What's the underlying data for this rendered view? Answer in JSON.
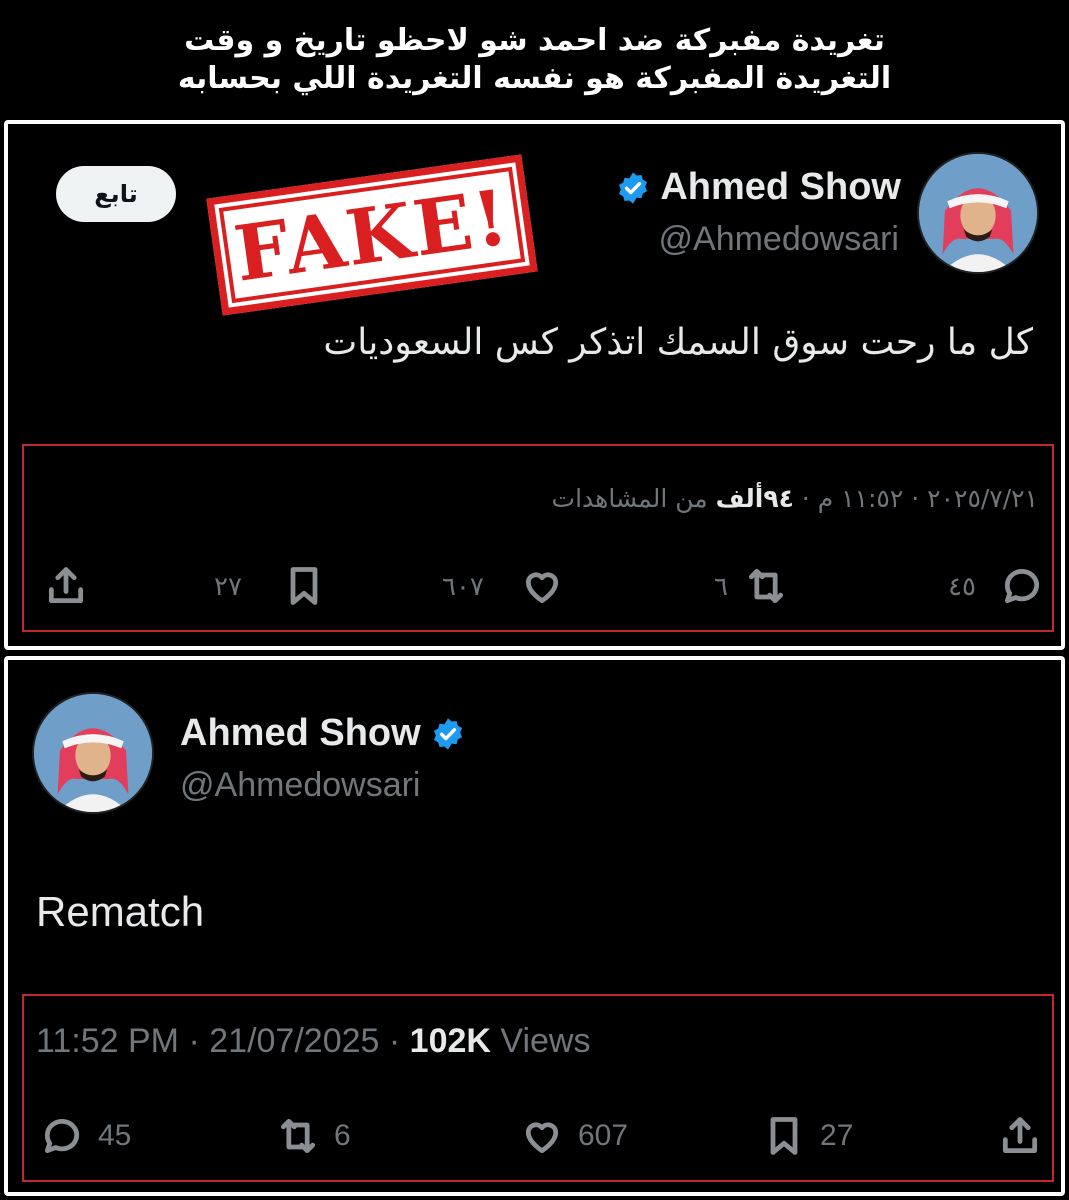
{
  "caption": {
    "line1": "تغريدة مفبركة ضد احمد شو لاحظو تاريخ و وقت",
    "line2": "التغريدة المفبركة هو نفسه التغريدة اللي بحسابه"
  },
  "fake_tweet": {
    "display_name": "Ahmed Show",
    "handle": "@Ahmedowsari",
    "follow_label": "تابع",
    "stamp_text": "FAKE!",
    "text": "كل ما رحت سوق السمك اتذكر كس السعوديات",
    "meta": {
      "date": "٢٠٢٥/٧/٢١",
      "time": "١١:٥٢ م",
      "views_count": "٩٤ألف",
      "views_label": "من المشاهدات"
    },
    "stats": {
      "replies": "٤٥",
      "reposts": "٦",
      "likes": "٦٠٧",
      "bookmarks": "٢٧"
    }
  },
  "real_tweet": {
    "display_name": "Ahmed Show",
    "handle": "@Ahmedowsari",
    "text": "Rematch",
    "meta": {
      "time": "11:52 PM",
      "date": "21/07/2025",
      "views_count": "102K",
      "views_label": "Views"
    },
    "stats": {
      "replies": "45",
      "reposts": "6",
      "likes": "607",
      "bookmarks": "27"
    }
  },
  "colors": {
    "background": "#000000",
    "verified": "#1d9bf0",
    "highlight_box": "#c0282d",
    "stamp": "#d91f1f",
    "muted_text": "#71767b"
  },
  "icons": [
    "reply-icon",
    "repost-icon",
    "like-icon",
    "bookmark-icon",
    "share-icon",
    "verified-badge-icon"
  ]
}
